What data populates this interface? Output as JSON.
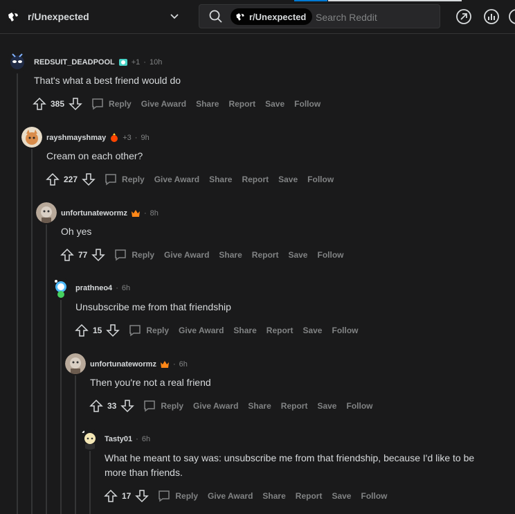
{
  "header": {
    "subreddit": "r/Unexpected",
    "search_chip": "r/Unexpected",
    "search_placeholder": "Search Reddit"
  },
  "actions": {
    "reply": "Reply",
    "give_award": "Give Award",
    "share": "Share",
    "report": "Report",
    "save": "Save",
    "follow": "Follow"
  },
  "comments": [
    {
      "user": "REDSUIT_DEADPOOL",
      "extra": "+1",
      "time": "10h",
      "body": "That's what a best friend would do",
      "score": "385"
    },
    {
      "user": "rayshmayshmay",
      "extra": "+3",
      "time": "9h",
      "body": "Cream on each other?",
      "score": "227"
    },
    {
      "user": "unfortunatewormz",
      "extra": "",
      "time": "8h",
      "body": "Oh yes",
      "score": "77"
    },
    {
      "user": "prathneo4",
      "extra": "",
      "time": "6h",
      "body": "Unsubscribe me from that friendship",
      "score": "15"
    },
    {
      "user": "unfortunatewormz",
      "extra": "",
      "time": "6h",
      "body": "Then you're not a real friend",
      "score": "33"
    },
    {
      "user": "Tasty01",
      "extra": "",
      "time": "6h",
      "body": "What he meant to say was: unsubscribe me from that friendship, because I'd like to be more than friends.",
      "score": "17"
    }
  ],
  "colors": {
    "background": "#1a1a1b",
    "text": "#d7dadc",
    "muted": "#818384",
    "line": "#343536"
  }
}
